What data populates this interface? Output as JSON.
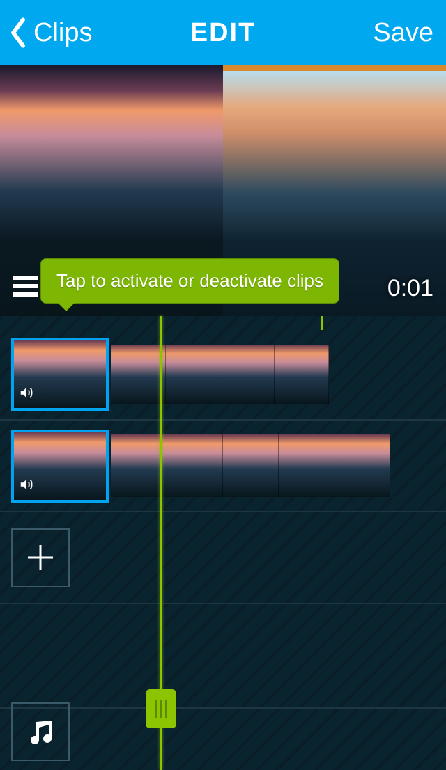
{
  "header": {
    "back_label": "Clips",
    "title": "EDIT",
    "save_label": "Save"
  },
  "preview": {
    "tooltip_text": "Tap to activate or deactivate clips",
    "time_label": "0:01"
  },
  "tracks": [
    {
      "frames_count": 4
    },
    {
      "frames_count": 5
    }
  ],
  "icons": {
    "back": "chevron-left-icon",
    "menu": "hamburger-icon",
    "sound": "speaker-icon",
    "add": "plus-icon",
    "music": "music-note-icon",
    "playhead_handle": "grip-icon"
  }
}
